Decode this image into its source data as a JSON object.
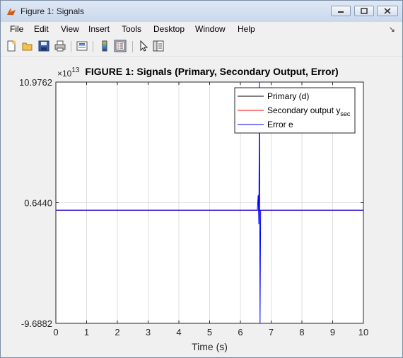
{
  "window": {
    "title": "Figure 1: Signals"
  },
  "menu": {
    "items": [
      "File",
      "Edit",
      "View",
      "Insert",
      "Tools",
      "Desktop",
      "Window",
      "Help"
    ],
    "dock_icon": "dock-arrow-icon"
  },
  "toolbar": {
    "icons": [
      "new-figure-icon",
      "open-file-icon",
      "save-icon",
      "print-icon",
      "link-plot-icon",
      "colorbar-icon",
      "legend-icon",
      "pointer-arrow-icon",
      "property-editor-icon"
    ]
  },
  "chart_data": {
    "type": "line",
    "title": "FIGURE 1: Signals (Primary, Secondary Output, Error)",
    "xlabel": "Time (s)",
    "ylabel": "",
    "y_exponent_label": "×10^13",
    "xlim": [
      0,
      10
    ],
    "ylim": [
      -9.6882,
      10.9762
    ],
    "xticks": [
      0,
      1,
      2,
      3,
      4,
      5,
      6,
      7,
      8,
      9,
      10
    ],
    "yticks": [
      -9.6882,
      0.644,
      10.9762
    ],
    "ytick_labels": [
      "-9.6882",
      "0.6440",
      "10.9762"
    ],
    "xtick_labels": [
      "0",
      "1",
      "2",
      "3",
      "4",
      "5",
      "6",
      "7",
      "8",
      "9",
      "10"
    ],
    "grid": true,
    "legend_position": "top-right",
    "series": [
      {
        "name": "Primary (d)",
        "color": "#000000",
        "x": [
          0,
          6.6,
          6.62,
          6.64,
          10
        ],
        "y": [
          0.0,
          0.0,
          0.0,
          0.0,
          0.0
        ]
      },
      {
        "name": "Secondary output y_sec",
        "color": "#ff0000",
        "x": [
          0,
          6.6,
          6.62,
          6.64,
          10
        ],
        "y": [
          0.0,
          0.0,
          0.0,
          0.0,
          0.0
        ]
      },
      {
        "name": "Error e",
        "color": "#0000ff",
        "x": [
          0,
          6.55,
          6.58,
          6.6,
          6.62,
          6.64,
          6.66,
          10
        ],
        "y": [
          0.0,
          0.0,
          1.3,
          -1.2,
          10.9762,
          -9.6882,
          0.0,
          0.0
        ]
      }
    ],
    "legend": [
      {
        "label": "Primary (d)",
        "sub": "",
        "color": "#000000"
      },
      {
        "label": "Secondary output y",
        "sub": "sec",
        "color": "#ff0000"
      },
      {
        "label": "Error e",
        "sub": "",
        "color": "#0000ff"
      }
    ]
  }
}
